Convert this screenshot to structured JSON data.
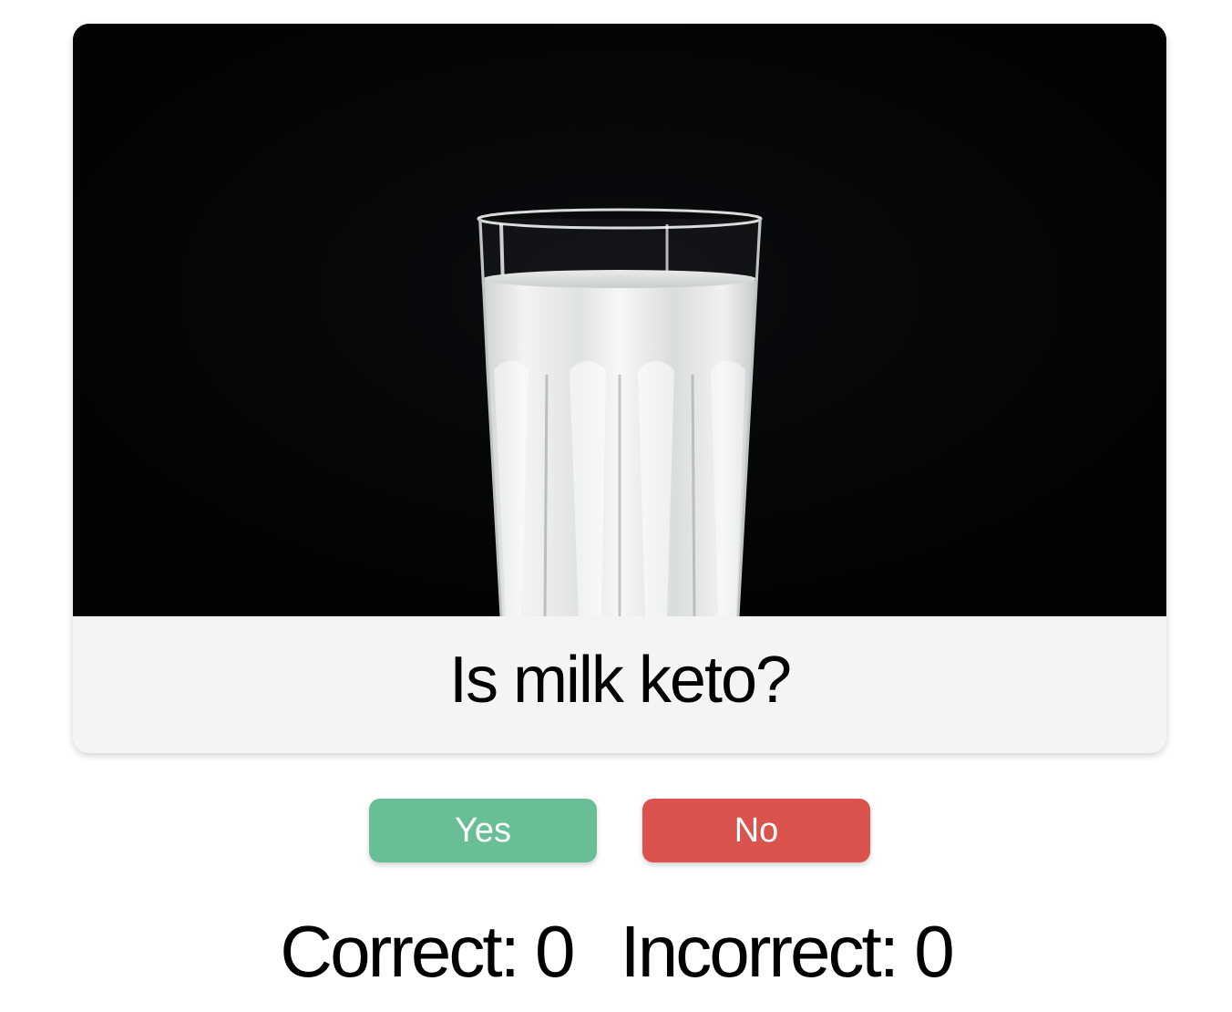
{
  "quiz": {
    "question": "Is milk keto?",
    "image_subject": "glass-of-milk"
  },
  "buttons": {
    "yes_label": "Yes",
    "no_label": "No"
  },
  "score": {
    "correct_label": "Correct:",
    "correct_value": "0",
    "incorrect_label": "Incorrect:",
    "incorrect_value": "0"
  },
  "colors": {
    "yes_button": "#68bf96",
    "no_button": "#da534c",
    "question_bar": "#f4f4f4",
    "photo_background": "#030303"
  }
}
